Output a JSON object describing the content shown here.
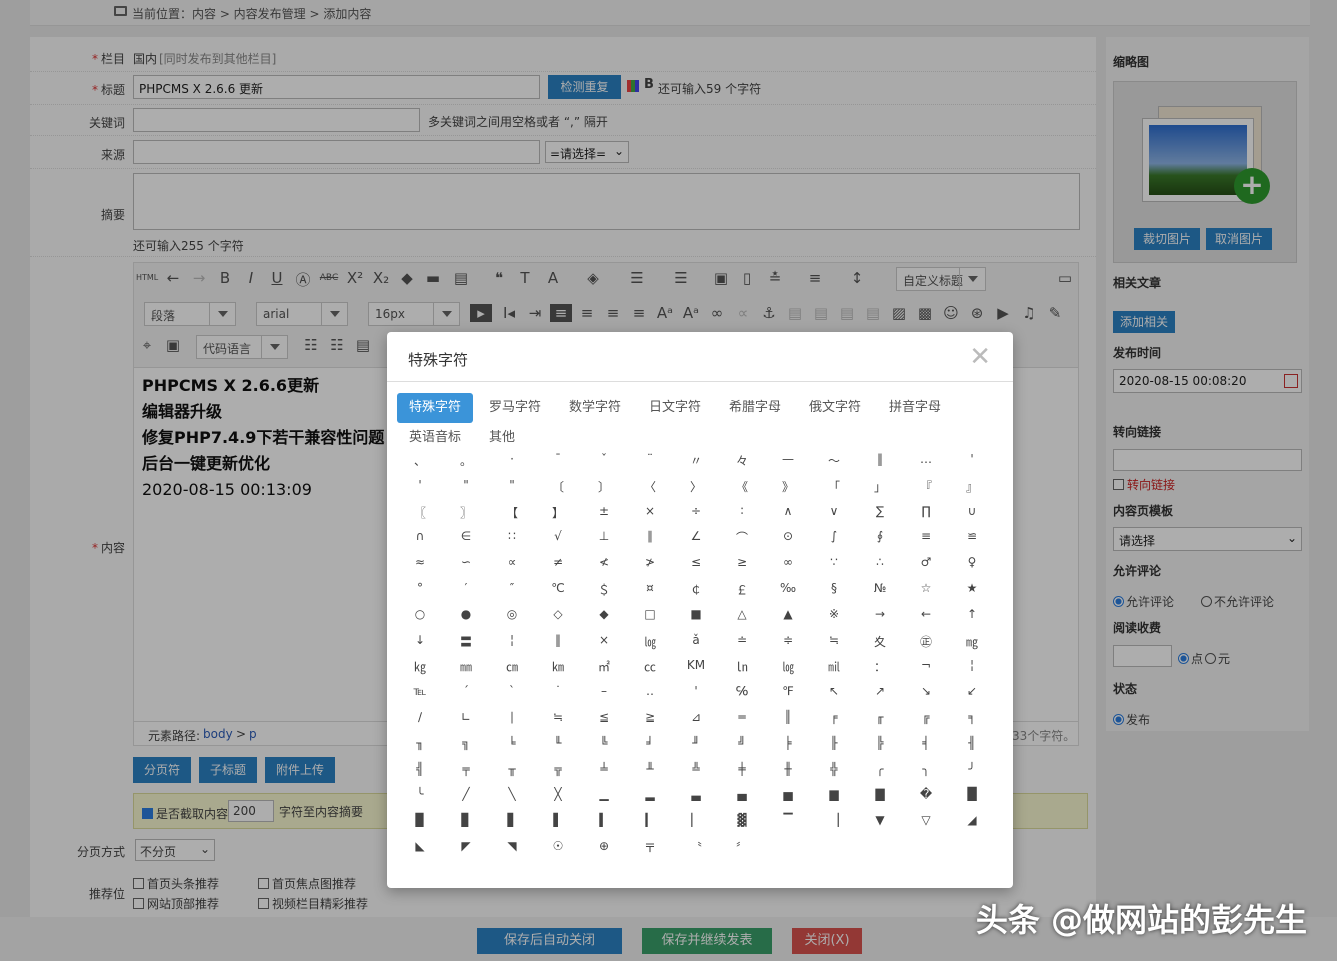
{
  "breadcrumb": "当前位置：内容 > 内容发布管理 > 添加内容",
  "form": {
    "column_label": "栏目",
    "column_value": "国内",
    "column_hint": "[同时发布到其他栏目]",
    "title_label": "标题",
    "title_value": "PHPCMS X 2.6.6 更新",
    "check_dup_button": "检测重复",
    "title_remaining": "还可输入59 个字符",
    "keywords_label": "关键词",
    "keywords_hint": "多关键词之间用空格或者 “,” 隔开",
    "source_label": "来源",
    "source_select": "=请选择=",
    "summary_label": "摘要",
    "summary_remaining": "还可输入255 个字符",
    "content_label": "内容",
    "paging_button": "分页符",
    "subtitle_button": "子标题",
    "attach_button": "附件上传",
    "auto_summary": "是否截取内容",
    "auto_summary_count": "200",
    "auto_summary_suffix": "字符至内容摘要",
    "paging_mode_label": "分页方式",
    "paging_mode_value": "不分页",
    "recommend_label": "推荐位",
    "recommend_items": [
      "首页头条推荐",
      "首页焦点图推荐",
      "网站顶部推荐",
      "视频栏目精彩推荐"
    ]
  },
  "editor": {
    "para_select": "段落",
    "font_select": "arial",
    "size_select": "16px",
    "custom_title": "自定义标题",
    "code_lang": "代码语言",
    "status_path_label": "元素路径:",
    "status_path_body": "body",
    "status_path_p": "p",
    "status_count": "33个字符。",
    "content_lines": [
      "PHPCMS X 2.6.6更新",
      "编辑器升级",
      "修复PHP7.4.9下若干兼容性问题",
      "后台一键更新优化"
    ],
    "content_date": "2020-08-15 00:13:09"
  },
  "sidebar": {
    "thumb_label": "缩略图",
    "crop_button": "裁切图片",
    "cancel_button": "取消图片",
    "related_label": "相关文章",
    "add_related_button": "添加相关",
    "pubtime_label": "发布时间",
    "pubtime_value": "2020-08-15 00:08:20",
    "redirect_label": "转向链接",
    "redirect_check": "转向链接",
    "template_label": "内容页模板",
    "template_value": "请选择",
    "comment_label": "允许评论",
    "comment_allow": "允许评论",
    "comment_deny": "不允许评论",
    "fee_label": "阅读收费",
    "fee_point": "点",
    "fee_yuan": "元",
    "status_label": "状态",
    "status_publish": "发布"
  },
  "dialog": {
    "title": "特殊字符",
    "tabs": [
      "特殊字符",
      "罗马字符",
      "数学字符",
      "日文字符",
      "希腊字母",
      "俄文字符",
      "拼音字母",
      "英语音标",
      "其他"
    ],
    "chars": [
      "、",
      "。",
      "·",
      "ˉ",
      "ˇ",
      "¨",
      "〃",
      "々",
      "—",
      "～",
      "‖",
      "…",
      "'",
      "'",
      "\"",
      "\"",
      "〔",
      "〕",
      "〈",
      "〉",
      "《",
      "》",
      "「",
      "」",
      "『",
      "』",
      "〖",
      "〗",
      "【",
      "】",
      "±",
      "×",
      "÷",
      "∶",
      "∧",
      "∨",
      "∑",
      "∏",
      "∪",
      "∩",
      "∈",
      "∷",
      "√",
      "⊥",
      "∥",
      "∠",
      "⌒",
      "⊙",
      "∫",
      "∮",
      "≡",
      "≌",
      "≈",
      "∽",
      "∝",
      "≠",
      "≮",
      "≯",
      "≤",
      "≥",
      "∞",
      "∵",
      "∴",
      "♂",
      "♀",
      "°",
      "′",
      "″",
      "℃",
      "＄",
      "¤",
      "￠",
      "￡",
      "‰",
      "§",
      "№",
      "☆",
      "★",
      "○",
      "●",
      "◎",
      "◇",
      "◆",
      "□",
      "■",
      "△",
      "▲",
      "※",
      "→",
      "←",
      "↑",
      "↓",
      "〓",
      "¦",
      "‖",
      "×",
      "㏒",
      "ǎ",
      "≐",
      "≑",
      "≒",
      "夊",
      "㊣",
      "㎎",
      "㎏",
      "㎜",
      "㎝",
      "㎞",
      "㎡",
      "㏄",
      "KM",
      "㏑",
      "㏒",
      "㏕",
      "：",
      "¬",
      "¦",
      "℡",
      "ˊ",
      "ˋ",
      "˙",
      "–",
      "‥",
      "'",
      "℅",
      "℉",
      "↖",
      "↗",
      "↘",
      "↙",
      "∕",
      "∟",
      "∣",
      "≒",
      "≦",
      "≧",
      "⊿",
      "═",
      "║",
      "╒",
      "╓",
      "╔",
      "╕",
      "╖",
      "╗",
      "╘",
      "╙",
      "╚",
      "╛",
      "╜",
      "╝",
      "╞",
      "╟",
      "╠",
      "╡",
      "╢",
      "╣",
      "╤",
      "╥",
      "╦",
      "╧",
      "╨",
      "╩",
      "╪",
      "╫",
      "╬",
      "╭",
      "╮",
      "╯",
      "╰",
      "╱",
      "╲",
      "╳",
      "▁",
      "▂",
      "▃",
      "▄",
      "▅",
      "▆",
      "▇",
      "�",
      "█",
      "▉",
      "▊",
      "▋",
      "▌",
      "▍",
      "▎",
      "▏",
      "▓",
      "▔",
      "▕",
      "▼",
      "▽",
      "◢",
      "◣",
      "◤",
      "◥",
      "☉",
      "⊕",
      "〒",
      "〝",
      "〞"
    ]
  },
  "footer": {
    "save_close": "保存后自动关闭",
    "save_continue": "保存并继续发表",
    "close": "关闭(X)"
  },
  "watermark": "头条 @做网站的彭先生"
}
